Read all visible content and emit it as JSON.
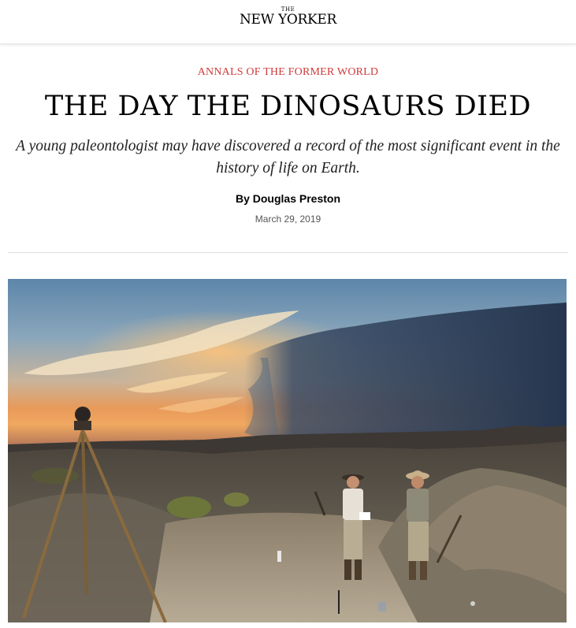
{
  "masthead": {
    "logo_small": "THE",
    "logo_main": "NEW YORKER"
  },
  "article": {
    "rubric": "ANNALS OF THE FORMER WORLD",
    "headline": "THE DAY THE DINOSAURS DIED",
    "dek": "A young paleontologist may have discovered a record of the most significant event in the history of life on Earth.",
    "byline": "By Douglas Preston",
    "date": "March 29, 2019"
  },
  "colors": {
    "rubric": "#cf3a3a",
    "text": "#000000",
    "date": "#555555"
  }
}
